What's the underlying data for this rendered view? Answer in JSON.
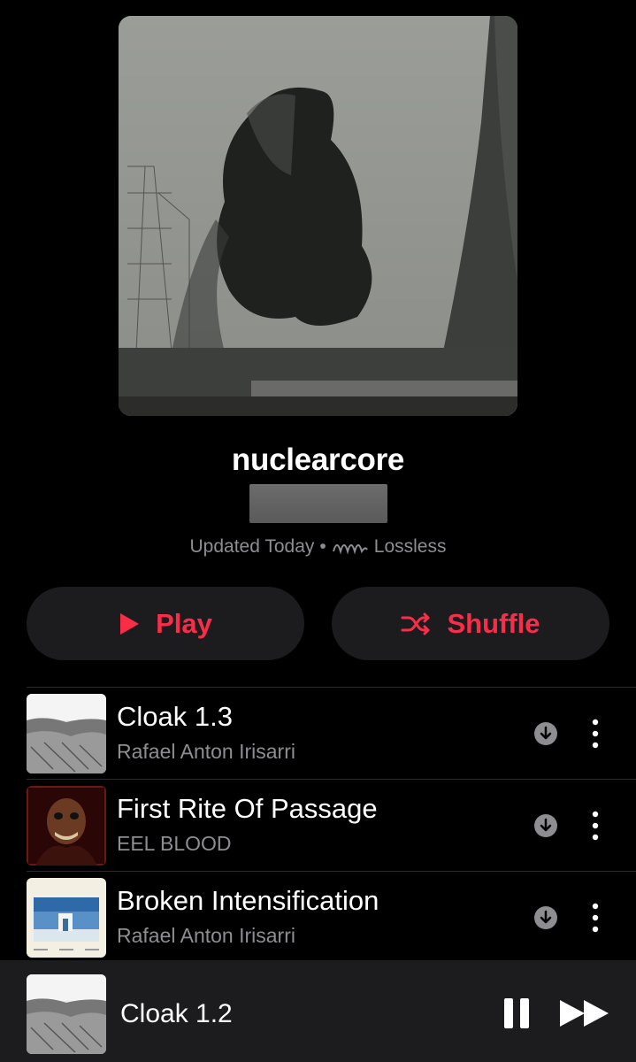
{
  "playlist": {
    "title": "nuclearcore",
    "updated": "Updated Today",
    "separator": "•",
    "quality": "Lossless",
    "quality_icon": "lossless-icon"
  },
  "actions": {
    "play_label": "Play",
    "shuffle_label": "Shuffle",
    "accent": "#fa2d48"
  },
  "tracks": [
    {
      "name": "Cloak 1.3",
      "artist": "Rafael Anton Irisarri"
    },
    {
      "name": "First Rite Of Passage",
      "artist": "EEL BLOOD"
    },
    {
      "name": "Broken Intensification",
      "artist": "Rafael Anton Irisarri"
    }
  ],
  "now_playing": {
    "name": "Cloak 1.2"
  }
}
